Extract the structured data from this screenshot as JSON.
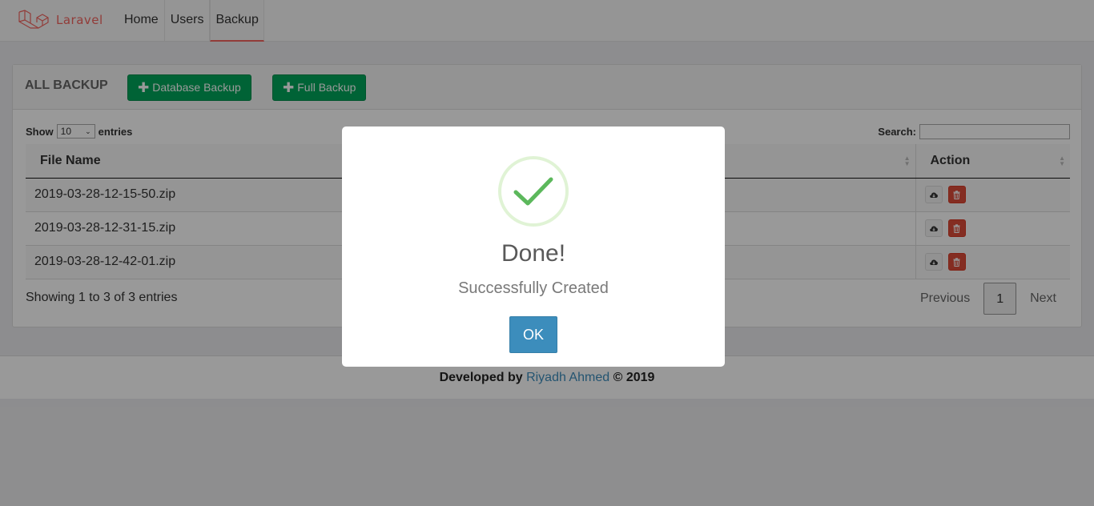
{
  "navbar": {
    "brand": "Laravel",
    "items": [
      {
        "label": "Home"
      },
      {
        "label": "Users"
      },
      {
        "label": "Backup"
      }
    ],
    "accent": "#f4645f"
  },
  "panel": {
    "title": "ALL BACKUP",
    "buttons": {
      "database_backup": "Database Backup",
      "full_backup": "Full Backup"
    }
  },
  "datatable": {
    "show_label": "Show",
    "entries_label": "entries",
    "page_length": "10",
    "search_label": "Search:",
    "search_value": "",
    "columns": [
      "File Name",
      "Action"
    ],
    "rows": [
      {
        "file_name": "2019-03-28-12-15-50.zip"
      },
      {
        "file_name": "2019-03-28-12-31-15.zip"
      },
      {
        "file_name": "2019-03-28-12-42-01.zip"
      }
    ],
    "info": "Showing 1 to 3 of 3 entries",
    "pagination": {
      "previous": "Previous",
      "current": "1",
      "next": "Next"
    }
  },
  "footer": {
    "prefix": "Developed by",
    "author": "Riyadh Ahmed",
    "suffix": "© 2019"
  },
  "modal": {
    "icon": "check-icon",
    "title": "Done!",
    "text": "Successfully Created",
    "ok_label": "OK",
    "icon_color": "#5cb85c",
    "button_color": "#3c8dbc"
  }
}
